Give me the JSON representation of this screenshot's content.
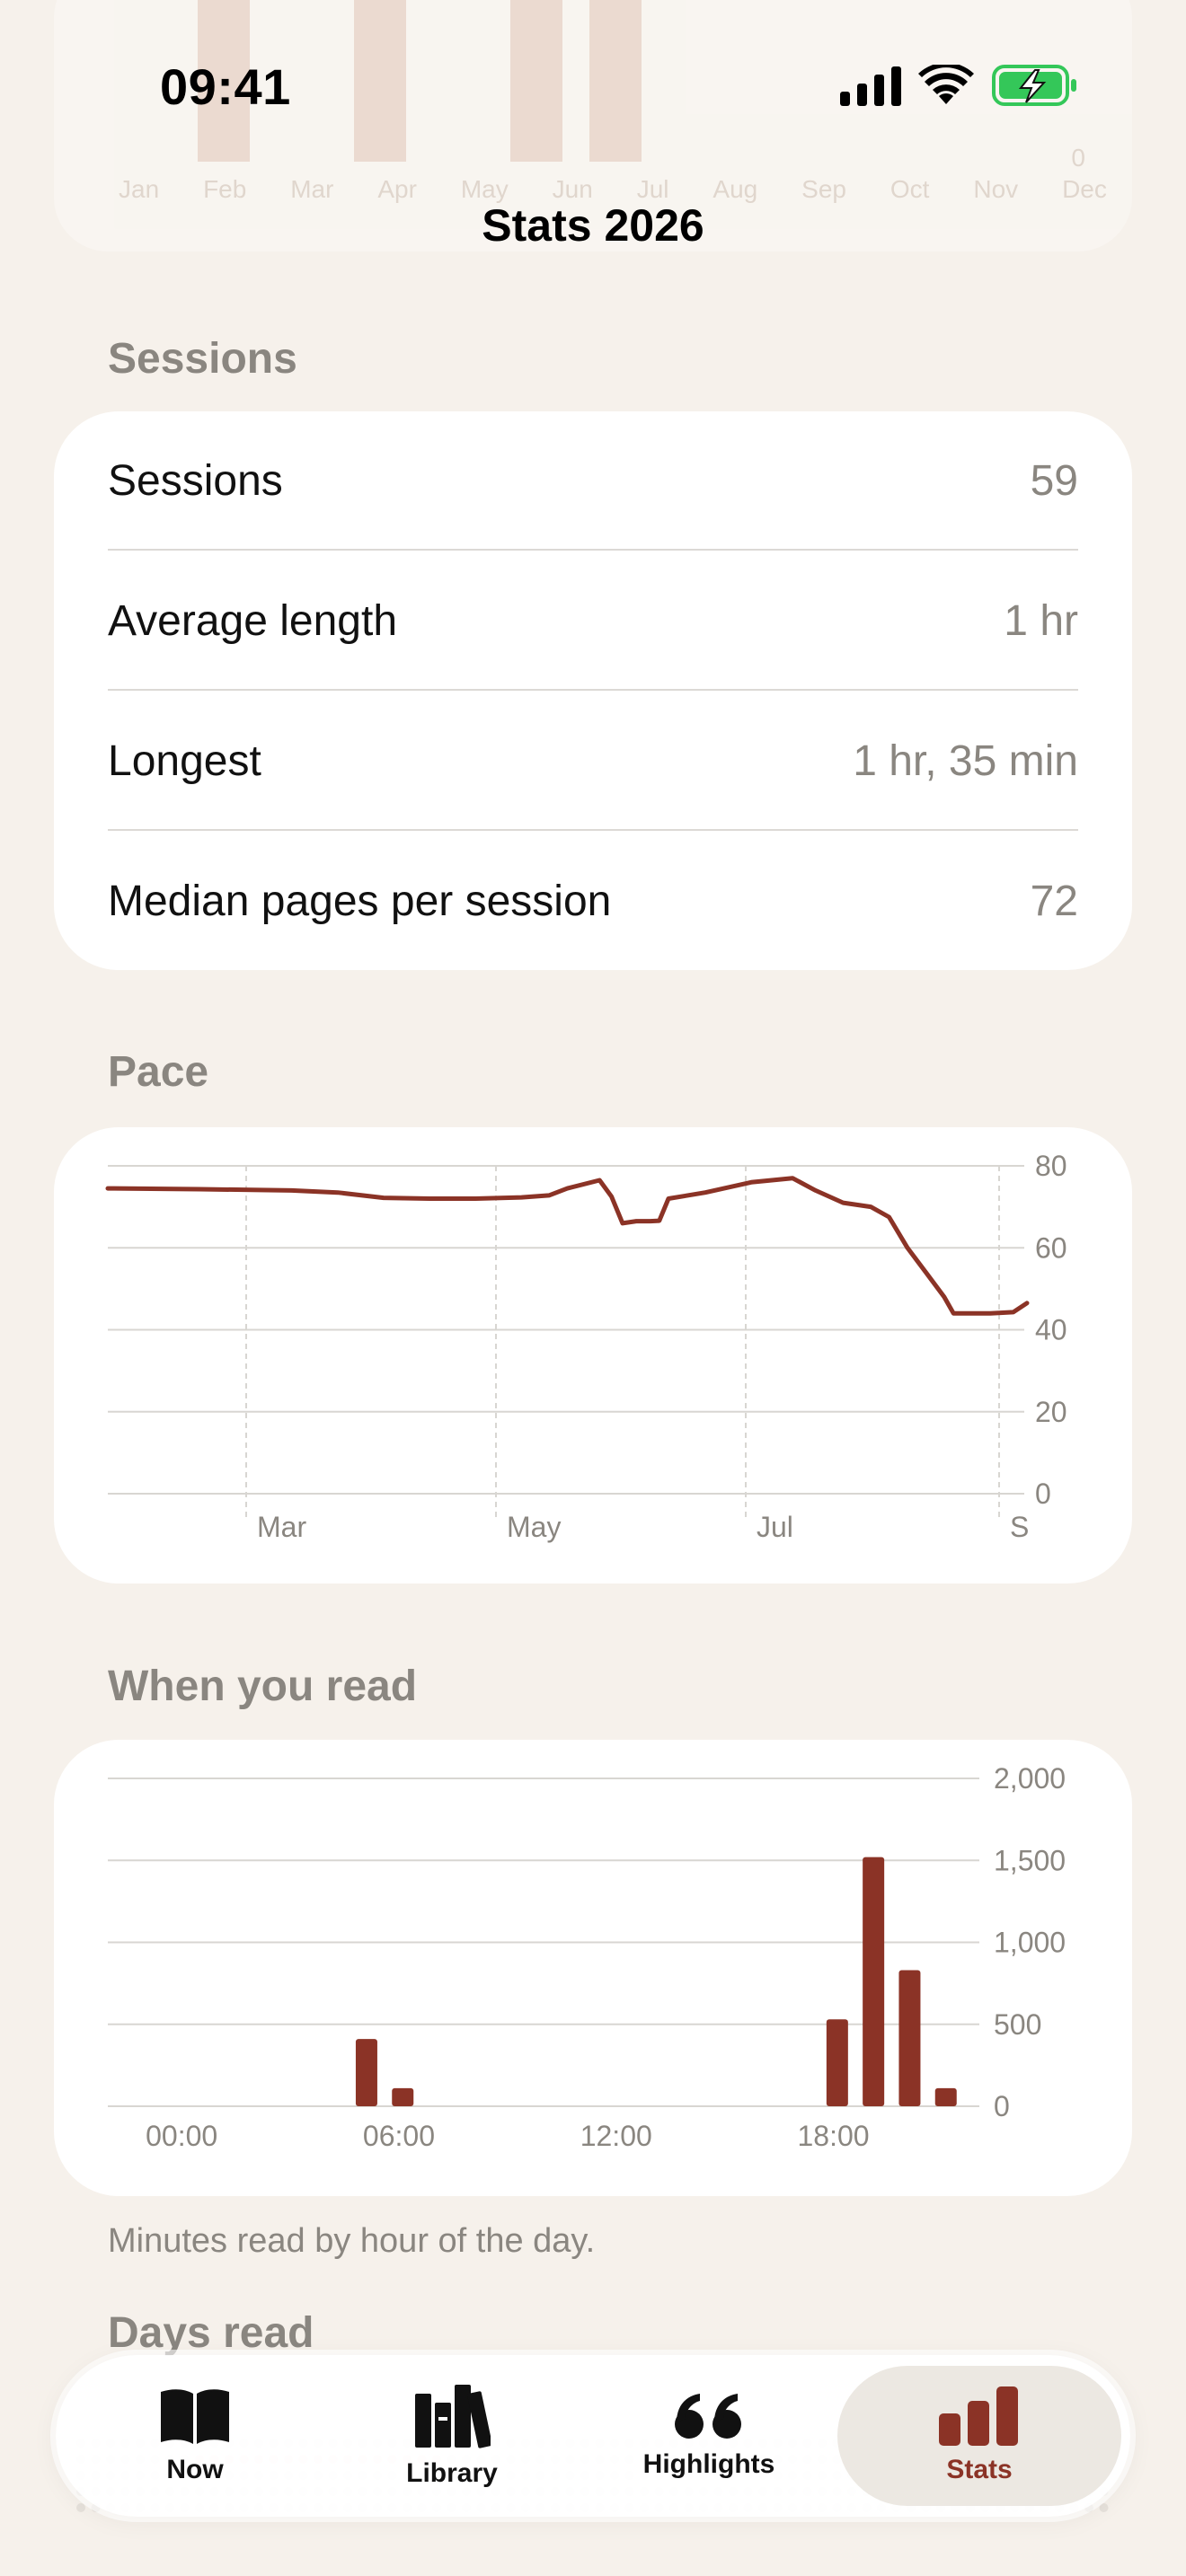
{
  "status_bar": {
    "time": "09:41"
  },
  "page_title": "Stats 2026",
  "ghost_chart": {
    "months": [
      "Jan",
      "Feb",
      "Mar",
      "Apr",
      "May",
      "Jun",
      "Jul",
      "Aug",
      "Sep",
      "Oct",
      "Nov",
      "Dec"
    ],
    "zero": "0"
  },
  "sessions": {
    "heading": "Sessions",
    "rows": [
      {
        "label": "Sessions",
        "value": "59"
      },
      {
        "label": "Average length",
        "value": "1 hr"
      },
      {
        "label": "Longest",
        "value": "1 hr, 35 min"
      },
      {
        "label": "Median pages per session",
        "value": "72"
      }
    ]
  },
  "pace": {
    "heading": "Pace",
    "chart_data": {
      "type": "line",
      "ylim": [
        0,
        80
      ],
      "yticks": [
        "0",
        "20",
        "40",
        "60",
        "80"
      ],
      "xticks": [
        "Mar",
        "May",
        "Jul",
        "S"
      ],
      "color": "#8b3326",
      "series": [
        {
          "values": [
            [
              0,
              74.5
            ],
            [
              0.1,
              74.3
            ],
            [
              0.2,
              74.0
            ],
            [
              0.25,
              73.5
            ],
            [
              0.3,
              72.2
            ],
            [
              0.35,
              72.0
            ],
            [
              0.4,
              72.0
            ],
            [
              0.45,
              72.3
            ],
            [
              0.48,
              72.8
            ],
            [
              0.5,
              74.5
            ],
            [
              0.535,
              76.5
            ],
            [
              0.548,
              72.5
            ],
            [
              0.56,
              66.0
            ],
            [
              0.575,
              66.5
            ],
            [
              0.59,
              66.5
            ],
            [
              0.6,
              66.6
            ],
            [
              0.61,
              72.0
            ],
            [
              0.65,
              73.5
            ],
            [
              0.7,
              76.0
            ],
            [
              0.745,
              77.0
            ],
            [
              0.77,
              74.0
            ],
            [
              0.8,
              71.0
            ],
            [
              0.83,
              70.0
            ],
            [
              0.85,
              67.5
            ],
            [
              0.87,
              60.0
            ],
            [
              0.89,
              54.0
            ],
            [
              0.91,
              48.0
            ],
            [
              0.92,
              44.0
            ],
            [
              0.94,
              44.0
            ],
            [
              0.96,
              44.0
            ],
            [
              0.985,
              44.3
            ],
            [
              1.0,
              46.5
            ]
          ]
        }
      ]
    }
  },
  "when_you_read": {
    "heading": "When you read",
    "caption": "Minutes read by hour of the day.",
    "chart_data": {
      "type": "bar",
      "ylim": [
        0,
        2000
      ],
      "yticks": [
        "0",
        "500",
        "1,000",
        "1,500",
        "2,000"
      ],
      "xticks": [
        "00:00",
        "06:00",
        "12:00",
        "18:00"
      ],
      "color": "#8b3326",
      "categories": [
        0,
        1,
        2,
        3,
        4,
        5,
        6,
        7,
        8,
        9,
        10,
        11,
        12,
        13,
        14,
        15,
        16,
        17,
        18,
        19,
        20,
        21,
        22,
        23
      ],
      "values": [
        0,
        0,
        0,
        0,
        0,
        0,
        410,
        110,
        0,
        0,
        0,
        0,
        0,
        0,
        0,
        0,
        0,
        0,
        0,
        530,
        1520,
        830,
        110,
        0
      ]
    }
  },
  "days_read": {
    "heading": "Days read"
  },
  "tabs": [
    {
      "label": "Now",
      "icon": "open-book-icon"
    },
    {
      "label": "Library",
      "icon": "books-icon"
    },
    {
      "label": "Highlights",
      "icon": "quote-icon"
    },
    {
      "label": "Stats",
      "icon": "bar-chart-icon",
      "active": true
    }
  ]
}
